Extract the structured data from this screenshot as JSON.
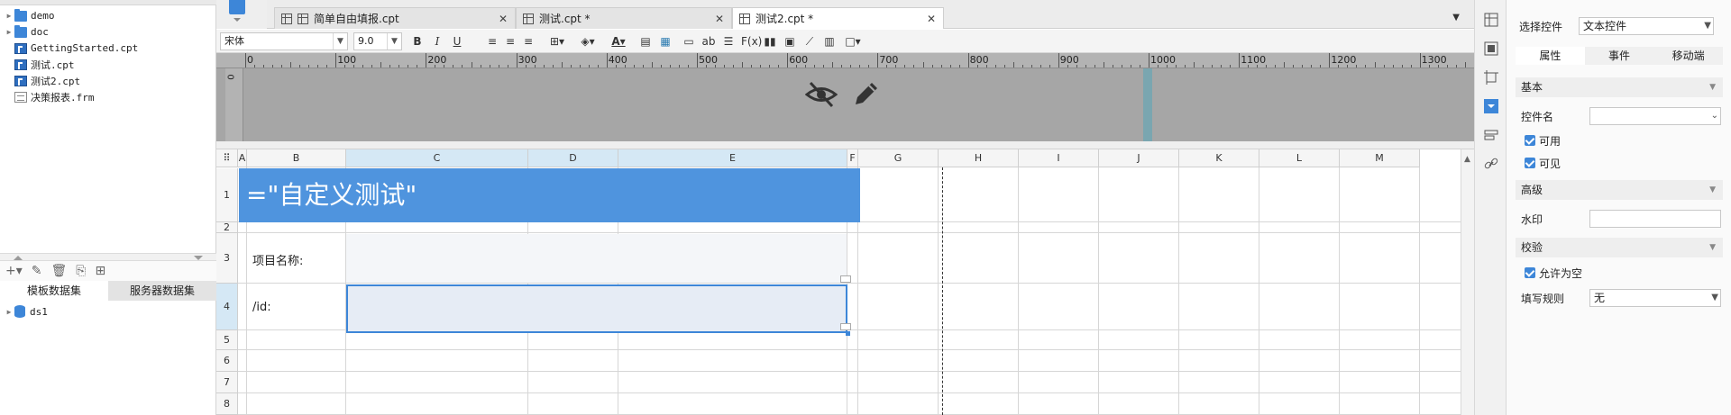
{
  "file_tree": {
    "items": [
      {
        "type": "folder",
        "name": "demo",
        "expandable": true
      },
      {
        "type": "folder",
        "name": "doc",
        "expandable": true
      },
      {
        "type": "cpt",
        "name": "GettingStarted.cpt",
        "expandable": false
      },
      {
        "type": "cpt",
        "name": "测试.cpt",
        "expandable": false
      },
      {
        "type": "cpt",
        "name": "测试2.cpt",
        "expandable": false
      },
      {
        "type": "frm",
        "name": "决策报表.frm",
        "expandable": false
      }
    ]
  },
  "dataset_panel": {
    "tabs": [
      {
        "label": "模板数据集",
        "active": true
      },
      {
        "label": "服务器数据集",
        "active": false
      }
    ],
    "items": [
      {
        "name": "ds1"
      }
    ]
  },
  "tabs": [
    {
      "label": "简单自由填报.cpt",
      "active": false
    },
    {
      "label": "测试.cpt *",
      "active": false
    },
    {
      "label": "测试2.cpt *",
      "active": true
    }
  ],
  "format_toolbar": {
    "font_name": "宋体",
    "font_size": "9.0",
    "bold": "B",
    "italic": "I",
    "underline": "U"
  },
  "ruler": {
    "marks": [
      "0",
      "100",
      "200",
      "300",
      "400",
      "500",
      "600",
      "700",
      "800",
      "900",
      "1000",
      "1100",
      "1200",
      "1300"
    ],
    "vertical_zero": "0"
  },
  "grid": {
    "columns": [
      "A",
      "B",
      "C",
      "D",
      "E",
      "F",
      "G",
      "H",
      "I",
      "J",
      "K",
      "L",
      "M"
    ],
    "rows": [
      "1",
      "2",
      "3",
      "4",
      "5",
      "6",
      "7",
      "8"
    ],
    "title_formula": "=\"自定义测试\"",
    "label_project": "项目名称:",
    "label_id": "/id:"
  },
  "properties": {
    "select_widget_label": "选择控件",
    "widget_type": "文本控件",
    "tabs": [
      {
        "label": "属性",
        "active": true
      },
      {
        "label": "事件",
        "active": false
      },
      {
        "label": "移动端",
        "active": false
      }
    ],
    "section_basic": "基本",
    "widget_name_label": "控件名",
    "widget_name_value": "",
    "enabled_label": "可用",
    "visible_label": "可见",
    "section_advanced": "高级",
    "watermark_label": "水印",
    "watermark_value": "",
    "section_validation": "校验",
    "allow_empty_label": "允许为空",
    "fill_rule_label": "填写规则",
    "fill_rule_value": "无"
  },
  "colors": {
    "accent": "#3d86d8",
    "title_cell": "#4f94de",
    "preview_bg": "#a6a6a6"
  }
}
